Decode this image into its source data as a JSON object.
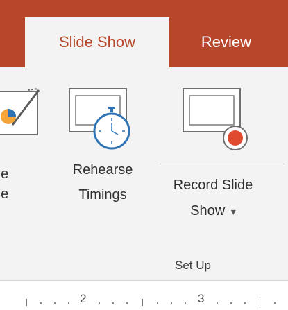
{
  "tabs": [
    {
      "label": "Slide Show",
      "active": true
    },
    {
      "label": "Review",
      "active": false
    }
  ],
  "ribbon": {
    "partial_button": {
      "line1": "de",
      "line2": "de"
    },
    "rehearse_timings": {
      "line1": "Rehearse",
      "line2": "Timings"
    },
    "record_slide_show": {
      "line1": "Record Slide",
      "line2": "Show",
      "dropdown": "▾"
    },
    "group_label": "Set Up"
  },
  "ruler": {
    "numbers": [
      "2",
      "3"
    ]
  },
  "colors": {
    "accent": "#b7472a",
    "ribbon_bg": "#f3f3f3",
    "record_dot": "#e04a2f",
    "clock_blue": "#2e74b5"
  },
  "icons": [
    "slide-partial-icon",
    "rehearse-timings-icon",
    "record-slide-show-icon",
    "dropdown-arrow-icon"
  ]
}
